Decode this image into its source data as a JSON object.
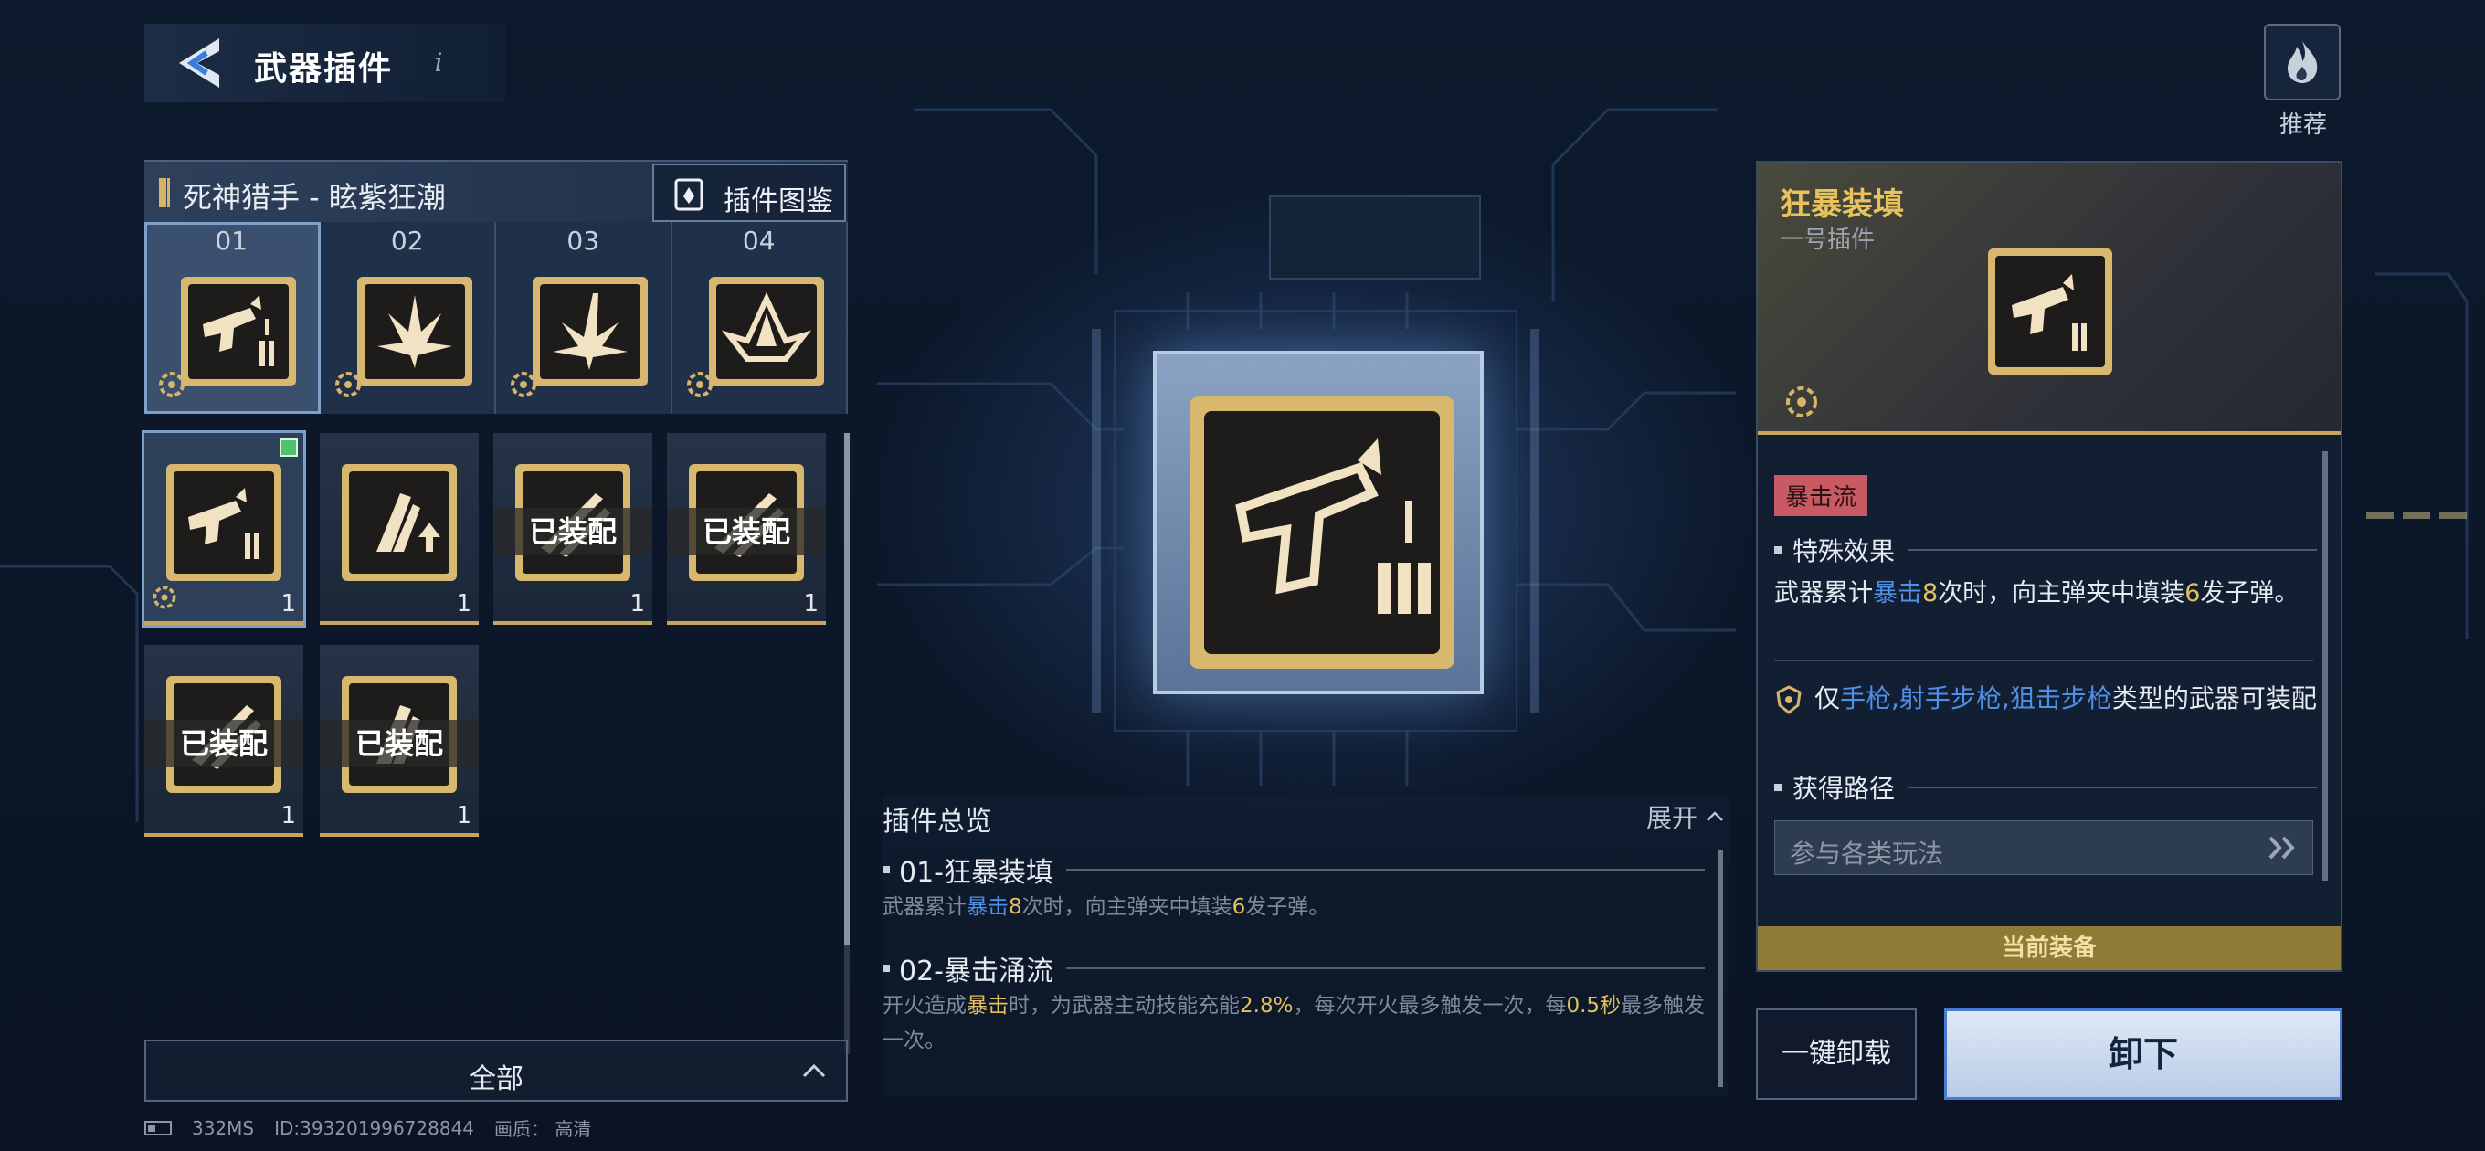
{
  "header": {
    "title": "武器插件",
    "info_glyph": "i",
    "icon": "back-arrow-icon"
  },
  "recommend": {
    "label": "推荐",
    "icon": "flame-icon"
  },
  "weapon": {
    "name": "死神猎手 - 眩紫狂潮",
    "atlas_label": "插件图鉴"
  },
  "slots": [
    {
      "num": "01",
      "icon": "pistol-ammo-icon",
      "selected": true
    },
    {
      "num": "02",
      "icon": "burst-icon",
      "selected": false
    },
    {
      "num": "03",
      "icon": "impact-icon",
      "selected": false
    },
    {
      "num": "04",
      "icon": "crystal-icon",
      "selected": false
    }
  ],
  "inventory": [
    {
      "icon": "pistol-ammo-icon",
      "count": "1",
      "equipped_label": "",
      "new": true,
      "selected": true
    },
    {
      "icon": "upgrade-icon",
      "count": "1",
      "equipped_label": "",
      "new": false,
      "selected": false
    },
    {
      "icon": "slash-icon",
      "count": "1",
      "equipped_label": "已装配",
      "new": false,
      "selected": false
    },
    {
      "icon": "slash-icon",
      "count": "1",
      "equipped_label": "已装配",
      "new": false,
      "selected": false
    },
    {
      "icon": "slash-icon",
      "count": "1",
      "equipped_label": "已装配",
      "new": false,
      "selected": false
    },
    {
      "icon": "slash-icon",
      "count": "1",
      "equipped_label": "已装配",
      "new": false,
      "selected": false
    }
  ],
  "filter": {
    "label": "全部"
  },
  "status": {
    "ping": "332MS",
    "id": "ID:393201996728844",
    "quality": "画质：  高清"
  },
  "overview": {
    "title": "插件总览",
    "expand_label": "展开",
    "items": [
      {
        "title": "01-狂暴装填",
        "desc": [
          {
            "t": "武器累计",
            "c": ""
          },
          {
            "t": "暴击",
            "c": "blue"
          },
          {
            "t": "8",
            "c": "gold"
          },
          {
            "t": "次时，向主弹夹中填装",
            "c": ""
          },
          {
            "t": "6",
            "c": "gold"
          },
          {
            "t": "发子弹。",
            "c": ""
          }
        ]
      },
      {
        "title": "02-暴击涌流",
        "desc": [
          {
            "t": "开火造成",
            "c": ""
          },
          {
            "t": "暴击",
            "c": "gold"
          },
          {
            "t": "时，为武器主动技能充能",
            "c": ""
          },
          {
            "t": "2.8%",
            "c": "gold"
          },
          {
            "t": "，每次开火最多触发一次，每",
            "c": ""
          },
          {
            "t": "0.5秒",
            "c": "gold"
          },
          {
            "t": "最多触发一次。",
            "c": ""
          }
        ]
      }
    ]
  },
  "detail": {
    "name": "狂暴装填",
    "subtitle": "一号插件",
    "tag": "暴击流",
    "effect_title": "特殊效果",
    "effect": [
      {
        "t": "武器累计",
        "c": ""
      },
      {
        "t": "暴击",
        "c": "blue"
      },
      {
        "t": "8",
        "c": "gold"
      },
      {
        "t": "次时，向主弹夹中填装",
        "c": ""
      },
      {
        "t": "6",
        "c": "gold"
      },
      {
        "t": "发子弹。",
        "c": ""
      }
    ],
    "restrict": [
      {
        "t": "仅",
        "c": ""
      },
      {
        "t": "手枪,射手步枪,狙击步枪",
        "c": "blue"
      },
      {
        "t": "类型的武器可装配",
        "c": ""
      }
    ],
    "source_title": "获得路径",
    "source_btn": "参与各类玩法",
    "current_label": "当前装备"
  },
  "actions": {
    "unload_all": "一键卸载",
    "unequip": "卸下"
  },
  "colors": {
    "gold": "#e3bf5d",
    "blue": "#4f8fe6",
    "accent_border": "#4a7bd0",
    "tag": "#c85a63"
  }
}
